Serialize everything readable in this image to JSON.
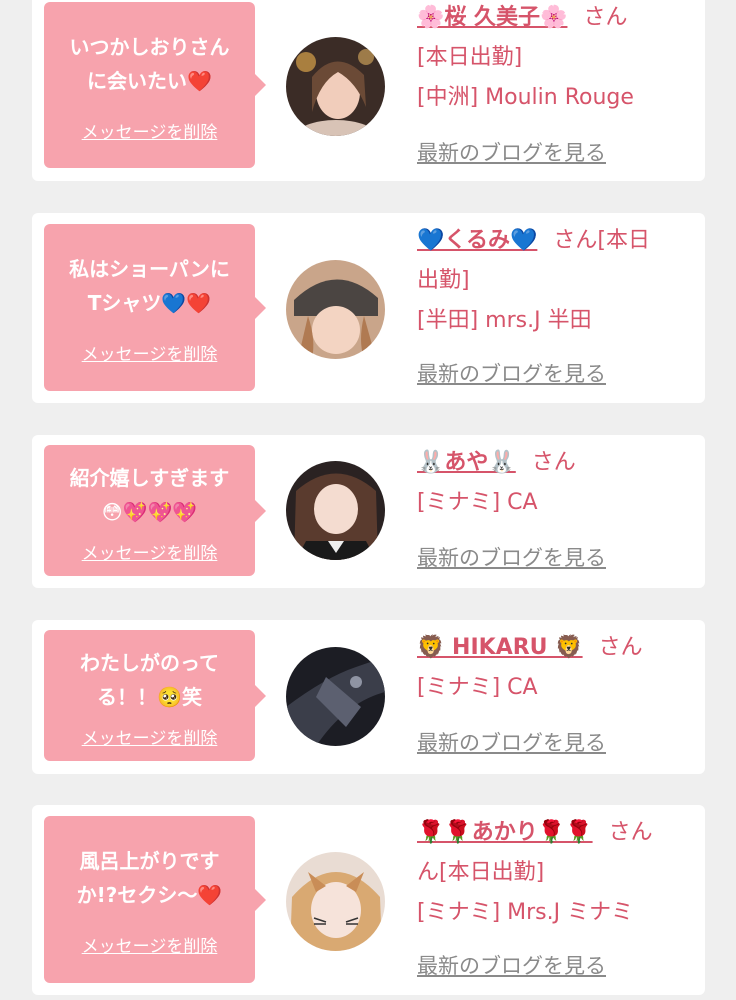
{
  "delete_label": "メッセージを削除",
  "blog_label": "最新のブログを見る",
  "san_label": "さん",
  "colors": {
    "background": "#efefef",
    "card": "#ffffff",
    "bubble": "#f7a3ad",
    "accent_text": "#d6546a",
    "link_gray": "#8a8a8a"
  },
  "messages": [
    {
      "message_line1": "いつかしおりさん",
      "message_line2": "に会いたい❤️",
      "name": "🌸桜 久美子🌸",
      "line1_suffix": "",
      "line2": "[本日出勤]",
      "line3": "[中洲] Moulin Rouge"
    },
    {
      "message_line1": "私はショーパンに",
      "message_line2": "Tシャツ💙❤️",
      "name": "💙くるみ💙",
      "line1_suffix": "[本日",
      "line2": "出勤]",
      "line3": "[半田] mrs.J 半田"
    },
    {
      "message_line1": "紹介嬉しすぎます",
      "message_line2": "😳💖💖💖",
      "name": "🐰あや🐰",
      "line1_suffix": "",
      "line2": "[ミナミ] CA",
      "line3": ""
    },
    {
      "message_line1": "わたしがのって",
      "message_line2": "る！！🥺笑",
      "name": "🦁 HIKARU 🦁",
      "line1_suffix": "",
      "line2": "[ミナミ] CA",
      "line3": ""
    },
    {
      "message_line1": "風呂上がりです",
      "message_line2": "か!?セクシ〜❤️",
      "name": "🌹🌹あかり🌹🌹",
      "line1_suffix": "",
      "line2": "ん[本日出勤]",
      "line3": "[ミナミ] Mrs.J ミナミ"
    }
  ]
}
